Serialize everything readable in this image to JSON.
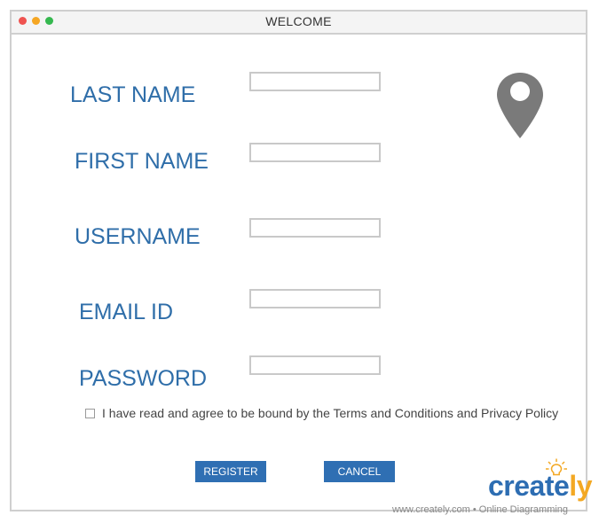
{
  "window": {
    "title": "WELCOME"
  },
  "form": {
    "fields": [
      {
        "label": "LAST NAME",
        "value": ""
      },
      {
        "label": "FIRST NAME",
        "value": ""
      },
      {
        "label": "USERNAME",
        "value": ""
      },
      {
        "label": "EMAIL ID",
        "value": ""
      },
      {
        "label": "PASSWORD",
        "value": ""
      }
    ],
    "terms": {
      "checked": false,
      "text": "I have read and agree to be bound by the Terms and Conditions and Privacy Policy"
    },
    "buttons": {
      "register": "REGISTER",
      "cancel": "CANCEL"
    }
  },
  "icons": {
    "location": "map-pin-icon"
  },
  "branding": {
    "logo": "creately",
    "footer": "www.creately.com • Online Diagramming"
  },
  "colors": {
    "label": "#2f6ea9",
    "button": "#2f6fb3",
    "pin": "#7a7a7a",
    "logo_blue": "#2d6db2",
    "logo_accent": "#f3a823"
  }
}
